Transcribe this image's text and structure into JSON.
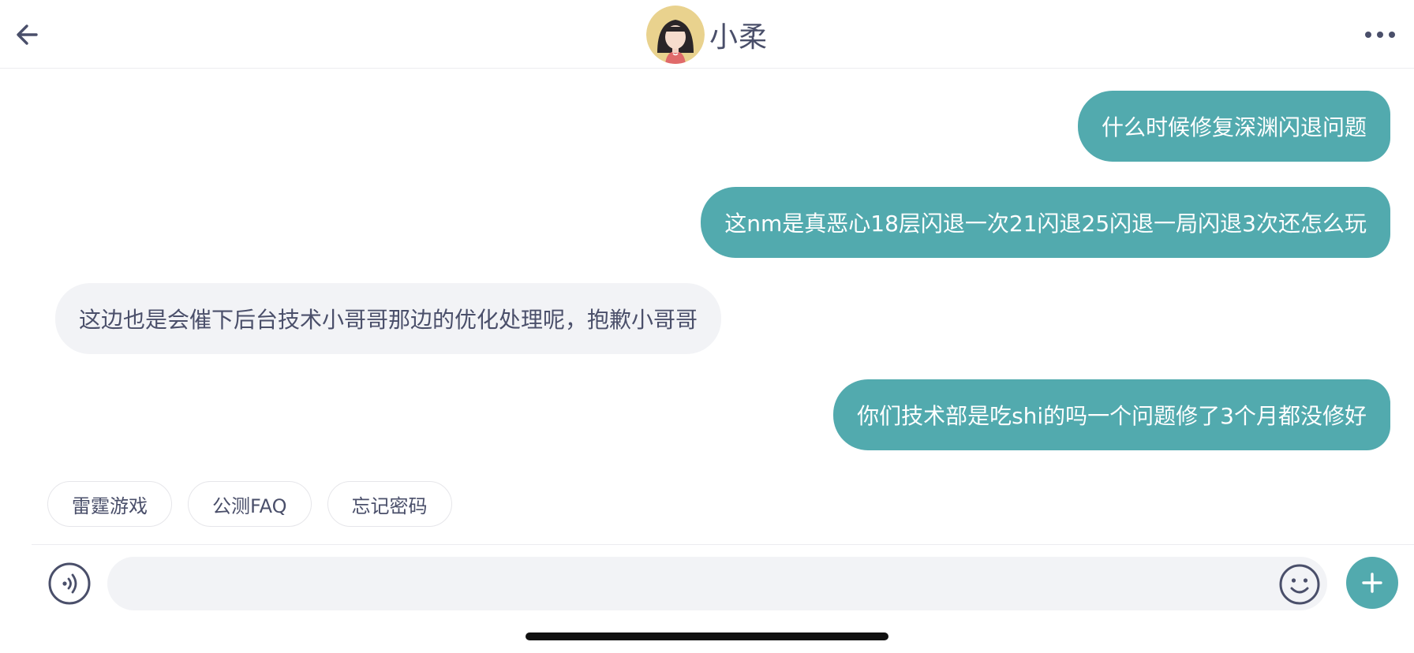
{
  "header": {
    "title": "小柔",
    "back_icon": "arrow-left-icon",
    "more_icon": "ellipsis-icon"
  },
  "messages": [
    {
      "from": "user",
      "text": "什么时候修复深渊闪退问题"
    },
    {
      "from": "user",
      "text": "这nm是真恶心18层闪退一次21闪退25闪退一局闪退3次还怎么玩"
    },
    {
      "from": "agent",
      "text": "这边也是会催下后台技术小哥哥那边的优化处理呢，抱歉小哥哥"
    },
    {
      "from": "user",
      "text": "你们技术部是吃shi的吗一个问题修了3个月都没修好"
    }
  ],
  "quick_replies": [
    "雷霆游戏",
    "公测FAQ",
    "忘记密码"
  ],
  "composer": {
    "input_value": "",
    "voice_icon": "voice-wave-icon",
    "emoji_icon": "smiley-icon",
    "plus_icon": "plus-icon"
  },
  "colors": {
    "accent": "#52aaae",
    "incoming_bubble": "#f2f3f6",
    "text": "#4a4f6a"
  }
}
